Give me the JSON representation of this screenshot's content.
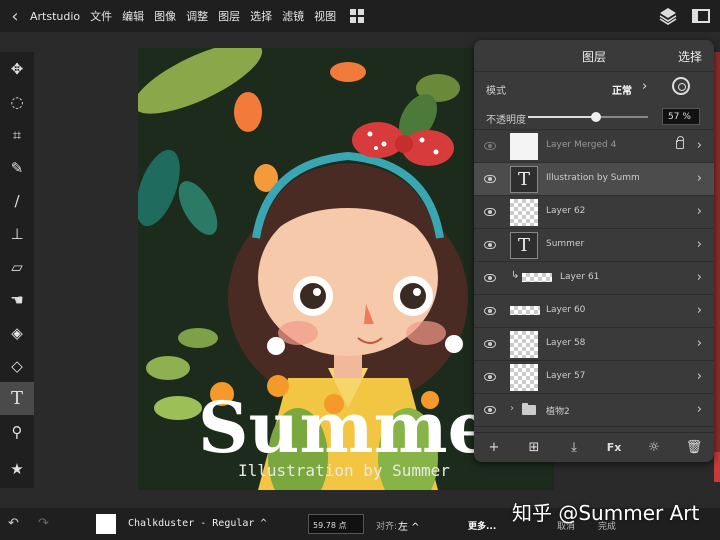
{
  "topbar": {
    "back_glyph": "‹",
    "app_name": "Artstudio",
    "menus": [
      "文件",
      "编辑",
      "图像",
      "调整",
      "图层",
      "选择",
      "滤镜",
      "视图"
    ],
    "icons": [
      "layers-icon",
      "window-icon"
    ]
  },
  "tools": [
    {
      "name": "move-tool",
      "glyph": "✥"
    },
    {
      "name": "selection-tool",
      "glyph": "◌"
    },
    {
      "name": "crop-tool",
      "glyph": "⌗"
    },
    {
      "name": "eyedropper-tool",
      "glyph": "✎"
    },
    {
      "name": "brush-tool",
      "glyph": "∕"
    },
    {
      "name": "stamp-tool",
      "glyph": "⊥"
    },
    {
      "name": "eraser-tool",
      "glyph": "▱"
    },
    {
      "name": "smudge-tool",
      "glyph": "☚"
    },
    {
      "name": "healing-tool",
      "glyph": "◈"
    },
    {
      "name": "fill-tool",
      "glyph": "◇"
    },
    {
      "name": "text-tool",
      "glyph": "T",
      "active": true
    },
    {
      "name": "zoom-tool",
      "glyph": "⚲"
    }
  ],
  "favorite_glyph": "★",
  "canvas": {
    "title_text": "Summer",
    "subtitle_text": "Illustration by Summer"
  },
  "layers_panel": {
    "title": "图层",
    "select_label": "选择",
    "mode_label": "模式",
    "mode_value": "正常",
    "opacity_label": "不透明度",
    "opacity_value": "57 %",
    "opacity_fraction": 0.57,
    "layers": [
      {
        "name": "Layer Merged 4",
        "thumb": "merged",
        "visible": false,
        "locked": true
      },
      {
        "name": "Illustration by Summ",
        "thumb": "text",
        "visible": true,
        "selected": true
      },
      {
        "name": "Layer 62",
        "thumb": "checker",
        "visible": true
      },
      {
        "name": "Summer",
        "thumb": "text",
        "visible": true
      },
      {
        "name": "Layer 61",
        "thumb": "strip",
        "visible": true,
        "clipped": true
      },
      {
        "name": "Layer 60",
        "thumb": "strip",
        "visible": true
      },
      {
        "name": "Layer 58",
        "thumb": "checker",
        "visible": true
      },
      {
        "name": "Layer 57",
        "thumb": "checker",
        "visible": true
      },
      {
        "name": "植物2",
        "thumb": "folder",
        "visible": true
      }
    ],
    "footer": {
      "add": "+",
      "add_group": "⊞",
      "import": "⤓",
      "fx": "Fx",
      "adjust": "☼",
      "delete": "🗑"
    }
  },
  "bottombar": {
    "undo": "↶",
    "redo": "↷",
    "font_label": "Chalkduster - Regular ^",
    "font_size": "59.78 点",
    "align_label": "对齐:",
    "align_value": "左 ^",
    "more": "更多...",
    "cancel": "取消",
    "done": "完成"
  },
  "watermark": "知乎 @Summer Art",
  "colors": {
    "ui_dark": "#1f1f1f",
    "panel": "#3a3a3a",
    "accent_red": "#c83a3a"
  }
}
